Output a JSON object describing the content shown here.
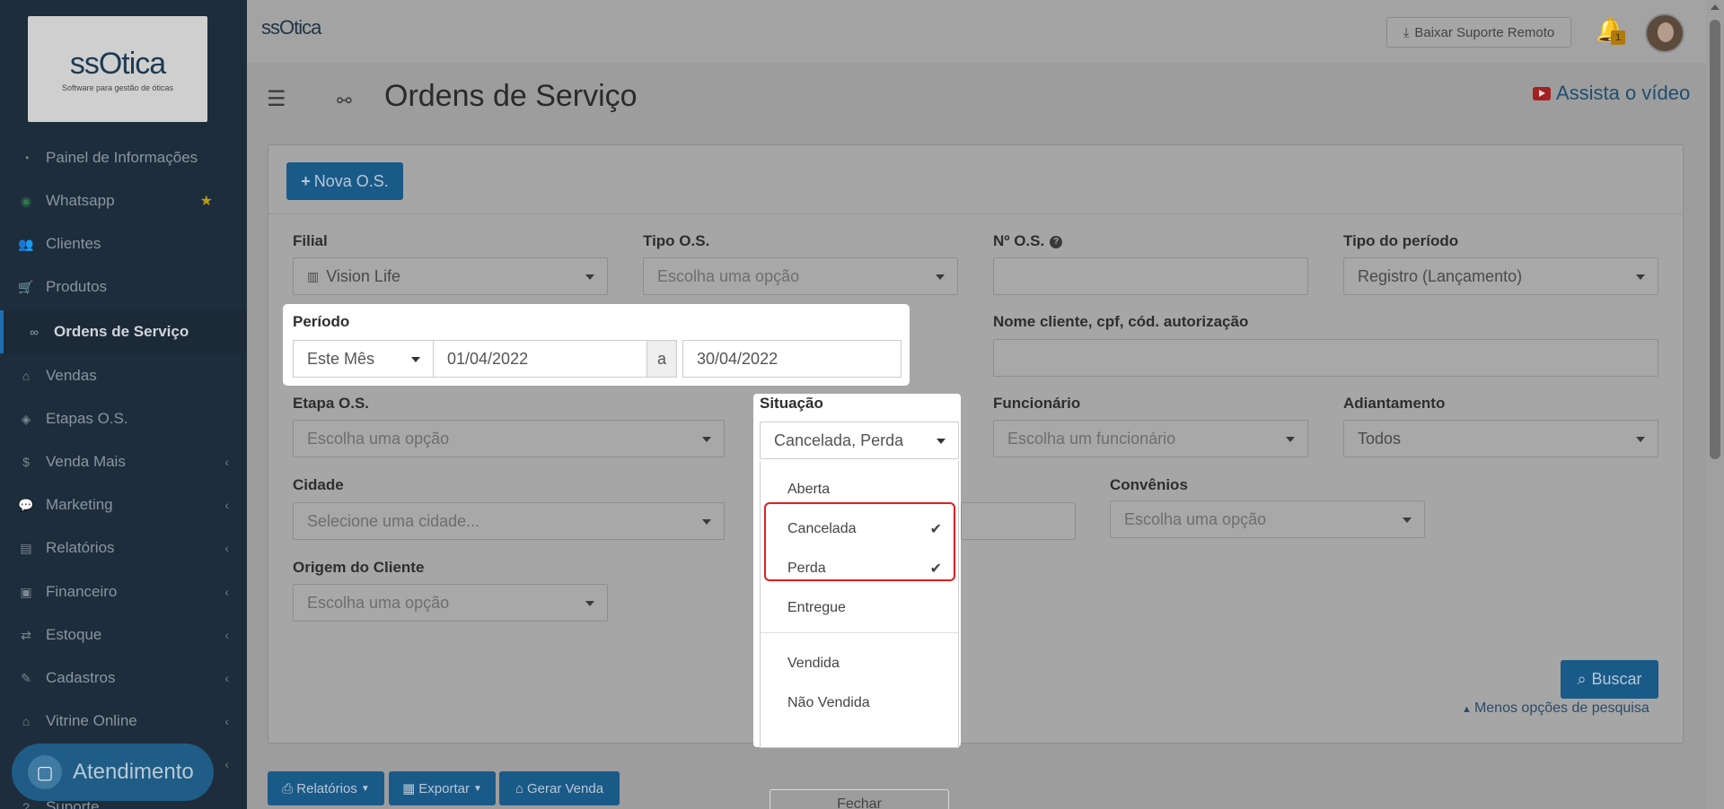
{
  "sidebar": {
    "logo": {
      "brand": "ssOtica",
      "tagline": "Software para gestão de óticas"
    },
    "items": [
      {
        "label": "Painel de Informações",
        "icon": "dashboard-icon"
      },
      {
        "label": "Whatsapp",
        "icon": "whatsapp-icon"
      },
      {
        "label": "Clientes",
        "icon": "users-icon"
      },
      {
        "label": "Produtos",
        "icon": "cart-icon"
      },
      {
        "label": "Ordens de Serviço",
        "icon": "glasses-icon"
      },
      {
        "label": "Vendas",
        "icon": "basket-icon"
      },
      {
        "label": "Etapas O.S.",
        "icon": "tag-icon"
      },
      {
        "label": "Venda Mais",
        "icon": "dollar-icon"
      },
      {
        "label": "Marketing",
        "icon": "comments-icon"
      },
      {
        "label": "Relatórios",
        "icon": "report-icon"
      },
      {
        "label": "Financeiro",
        "icon": "money-icon"
      },
      {
        "label": "Estoque",
        "icon": "exchange-icon"
      },
      {
        "label": "Cadastros",
        "icon": "edit-icon"
      },
      {
        "label": "Vitrine Online",
        "icon": "store-icon"
      },
      {
        "label": "Suporte",
        "icon": "support-icon"
      }
    ],
    "atendimento": "Atendimento"
  },
  "topbar": {
    "logo": "ssOtica",
    "suporte_button": "Baixar Suporte Remoto",
    "notification_count": "1"
  },
  "page": {
    "title": "Ordens de Serviço",
    "video_link": "Assista o vídeo"
  },
  "form": {
    "nova_os": "Nova O.S.",
    "filial": {
      "label": "Filial",
      "value": "Vision Life"
    },
    "tipo_os": {
      "label": "Tipo O.S.",
      "placeholder": "Escolha uma opção"
    },
    "numero_os": {
      "label": "Nº O.S.",
      "value": ""
    },
    "tipo_periodo": {
      "label": "Tipo do período",
      "value": "Registro (Lançamento)"
    },
    "periodo": {
      "label": "Período",
      "preset": "Este Mês",
      "from": "01/04/2022",
      "sep": "a",
      "to": "30/04/2022"
    },
    "nome_cliente": {
      "label": "Nome cliente, cpf, cód. autorização",
      "value": ""
    },
    "etapa_os": {
      "label": "Etapa O.S.",
      "placeholder": "Escolha uma opção"
    },
    "situacao": {
      "label": "Situação",
      "value": "Cancelada, Perda",
      "options": [
        {
          "label": "Aberta",
          "checked": ""
        },
        {
          "label": "Cancelada",
          "checked": "✔"
        },
        {
          "label": "Perda",
          "checked": "✔"
        },
        {
          "label": "Entregue",
          "checked": ""
        },
        {
          "label": "Vendida",
          "checked": ""
        },
        {
          "label": "Não Vendida",
          "checked": ""
        }
      ],
      "close": "Fechar"
    },
    "funcionario": {
      "label": "Funcionário",
      "placeholder": "Escolha um funcionário"
    },
    "adiantamento": {
      "label": "Adiantamento",
      "value": "Todos"
    },
    "cidade": {
      "label": "Cidade",
      "placeholder": "Selecione uma cidade..."
    },
    "convenios": {
      "label": "Convênios",
      "placeholder": "Escolha uma opção"
    },
    "origem": {
      "label": "Origem do Cliente",
      "placeholder": "Escolha uma opção"
    },
    "buscar": "Buscar",
    "menos_opcoes": "Menos opções de pesquisa"
  },
  "bottom": {
    "relatorios": "Relatórios",
    "exportar": "Exportar",
    "gerar_venda": "Gerar Venda"
  },
  "colors": {
    "primary": "#1a5a88",
    "highlight": "#e01e1e",
    "sidebar": "#1e2d3b"
  }
}
